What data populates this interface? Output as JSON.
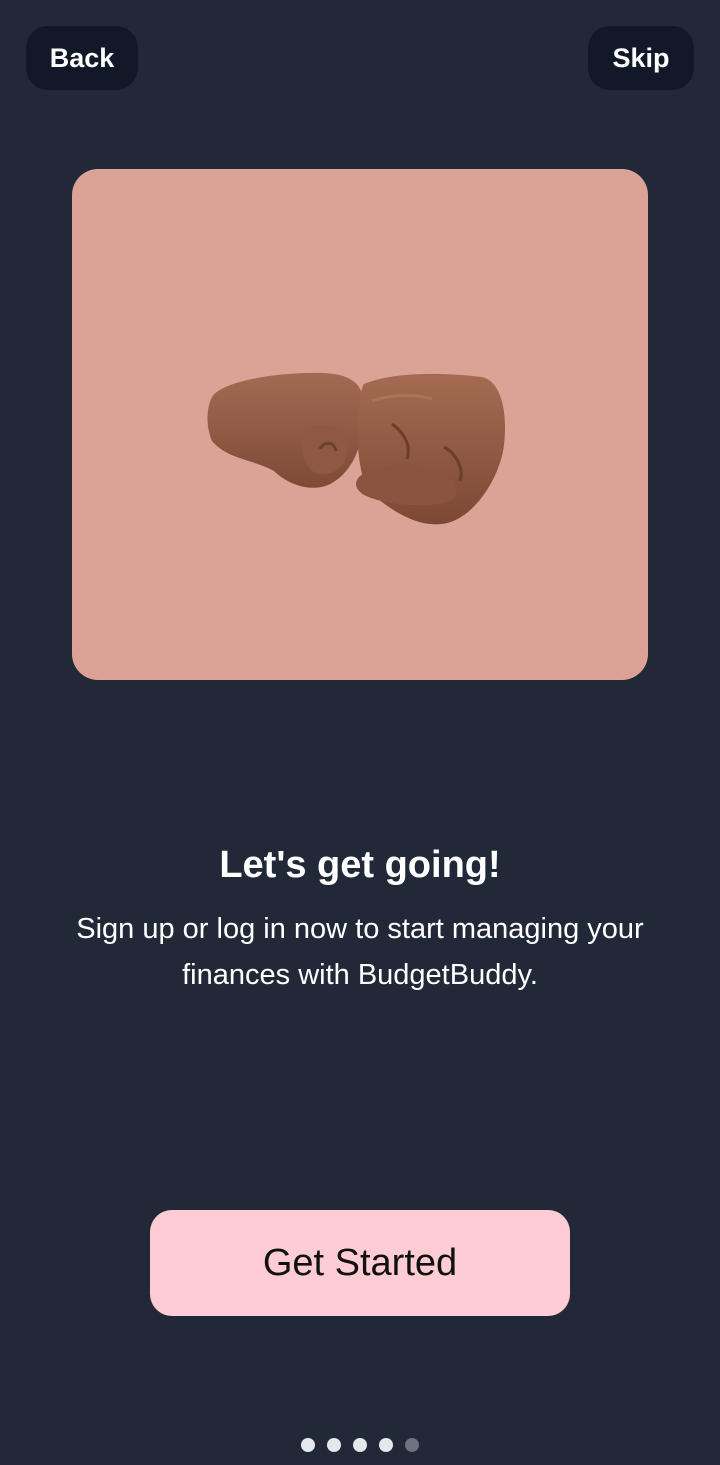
{
  "header": {
    "back_label": "Back",
    "skip_label": "Skip"
  },
  "hero": {
    "illustration": "fist-bump-icon",
    "background_color": "#dba296"
  },
  "content": {
    "title": "Let's get going!",
    "subtitle": "Sign up or log in now to start managing your finances with BudgetBuddy."
  },
  "cta": {
    "label": "Get Started",
    "color": "#fecdd3"
  },
  "pagination": {
    "total": 5,
    "current_index": 4
  },
  "colors": {
    "background": "#212938",
    "button_dark": "#111827",
    "dot": "#e5e7eb",
    "dot_active": "#6b7280"
  }
}
